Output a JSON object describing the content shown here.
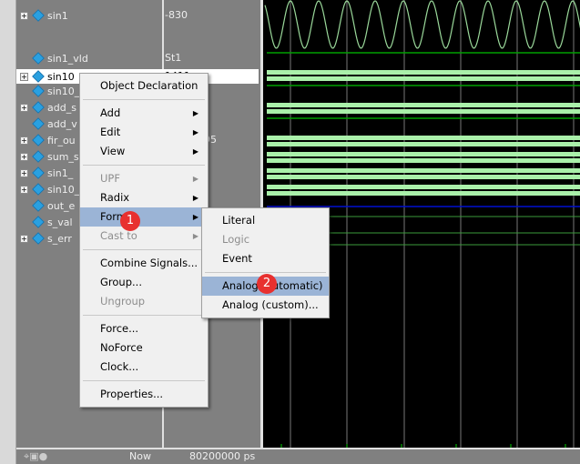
{
  "signals": [
    {
      "name": "sin1",
      "value": "-830",
      "expand": true
    },
    {
      "name": "sin1_vld",
      "value": "St1",
      "expand": false
    },
    {
      "name": "sin10",
      "value": "1411",
      "expand": true,
      "selected": true
    },
    {
      "name": "sin10_",
      "value": "",
      "expand": false
    },
    {
      "name": "add_s",
      "value": "",
      "expand": true
    },
    {
      "name": "add_v",
      "value": "",
      "expand": false
    },
    {
      "name": "fir_ou",
      "value": "95",
      "expand": true
    },
    {
      "name": "sum_s",
      "value": "",
      "expand": true
    },
    {
      "name": "sin1_",
      "value": "",
      "expand": true
    },
    {
      "name": "sin10_",
      "value": "",
      "expand": true
    },
    {
      "name": "out_e",
      "value": "",
      "expand": false
    },
    {
      "name": "s_val",
      "value": "",
      "expand": false
    },
    {
      "name": "s_err",
      "value": "",
      "expand": true
    }
  ],
  "context_menu": {
    "items": [
      "Object Declaration",
      "Add",
      "Edit",
      "View",
      "UPF",
      "Radix",
      "Format",
      "Cast to",
      "Combine Signals...",
      "Group...",
      "Ungroup",
      "Force...",
      "NoForce",
      "Clock...",
      "Properties..."
    ]
  },
  "format_submenu": {
    "items": [
      "Literal",
      "Logic",
      "Event",
      "Analog (automatic)",
      "Analog (custom)..."
    ]
  },
  "badges": [
    "1",
    "2"
  ],
  "bottom": {
    "now_label": "Now",
    "now_value": "80200000 ps"
  },
  "colors": {
    "wave_green": "#aaf0aa",
    "line_green": "#00a000",
    "highlight": "#9bb4d6",
    "badge": "#e8302f"
  }
}
